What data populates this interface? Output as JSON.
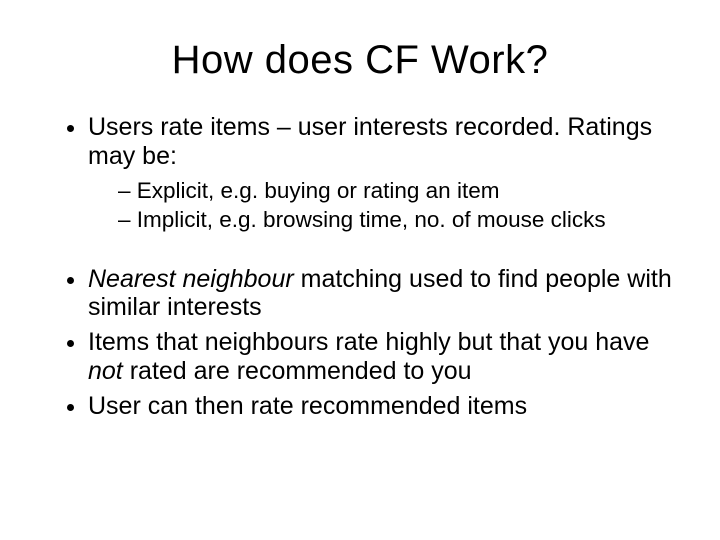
{
  "title": "How does CF Work?",
  "bullets": {
    "item1": {
      "text": "Users rate items – user interests recorded. Ratings may be:",
      "sub1": "Explicit, e.g. buying or rating an item",
      "sub2": "Implicit, e.g. browsing time, no. of mouse clicks"
    },
    "item2": {
      "lead_italic": "Nearest neighbour",
      "rest": " matching used to find people with similar interests"
    },
    "item3": {
      "part1": "Items that neighbours rate highly but that you have ",
      "italic": "not",
      "part2": " rated are recommended to you"
    },
    "item4": "User can then rate recommended items"
  }
}
